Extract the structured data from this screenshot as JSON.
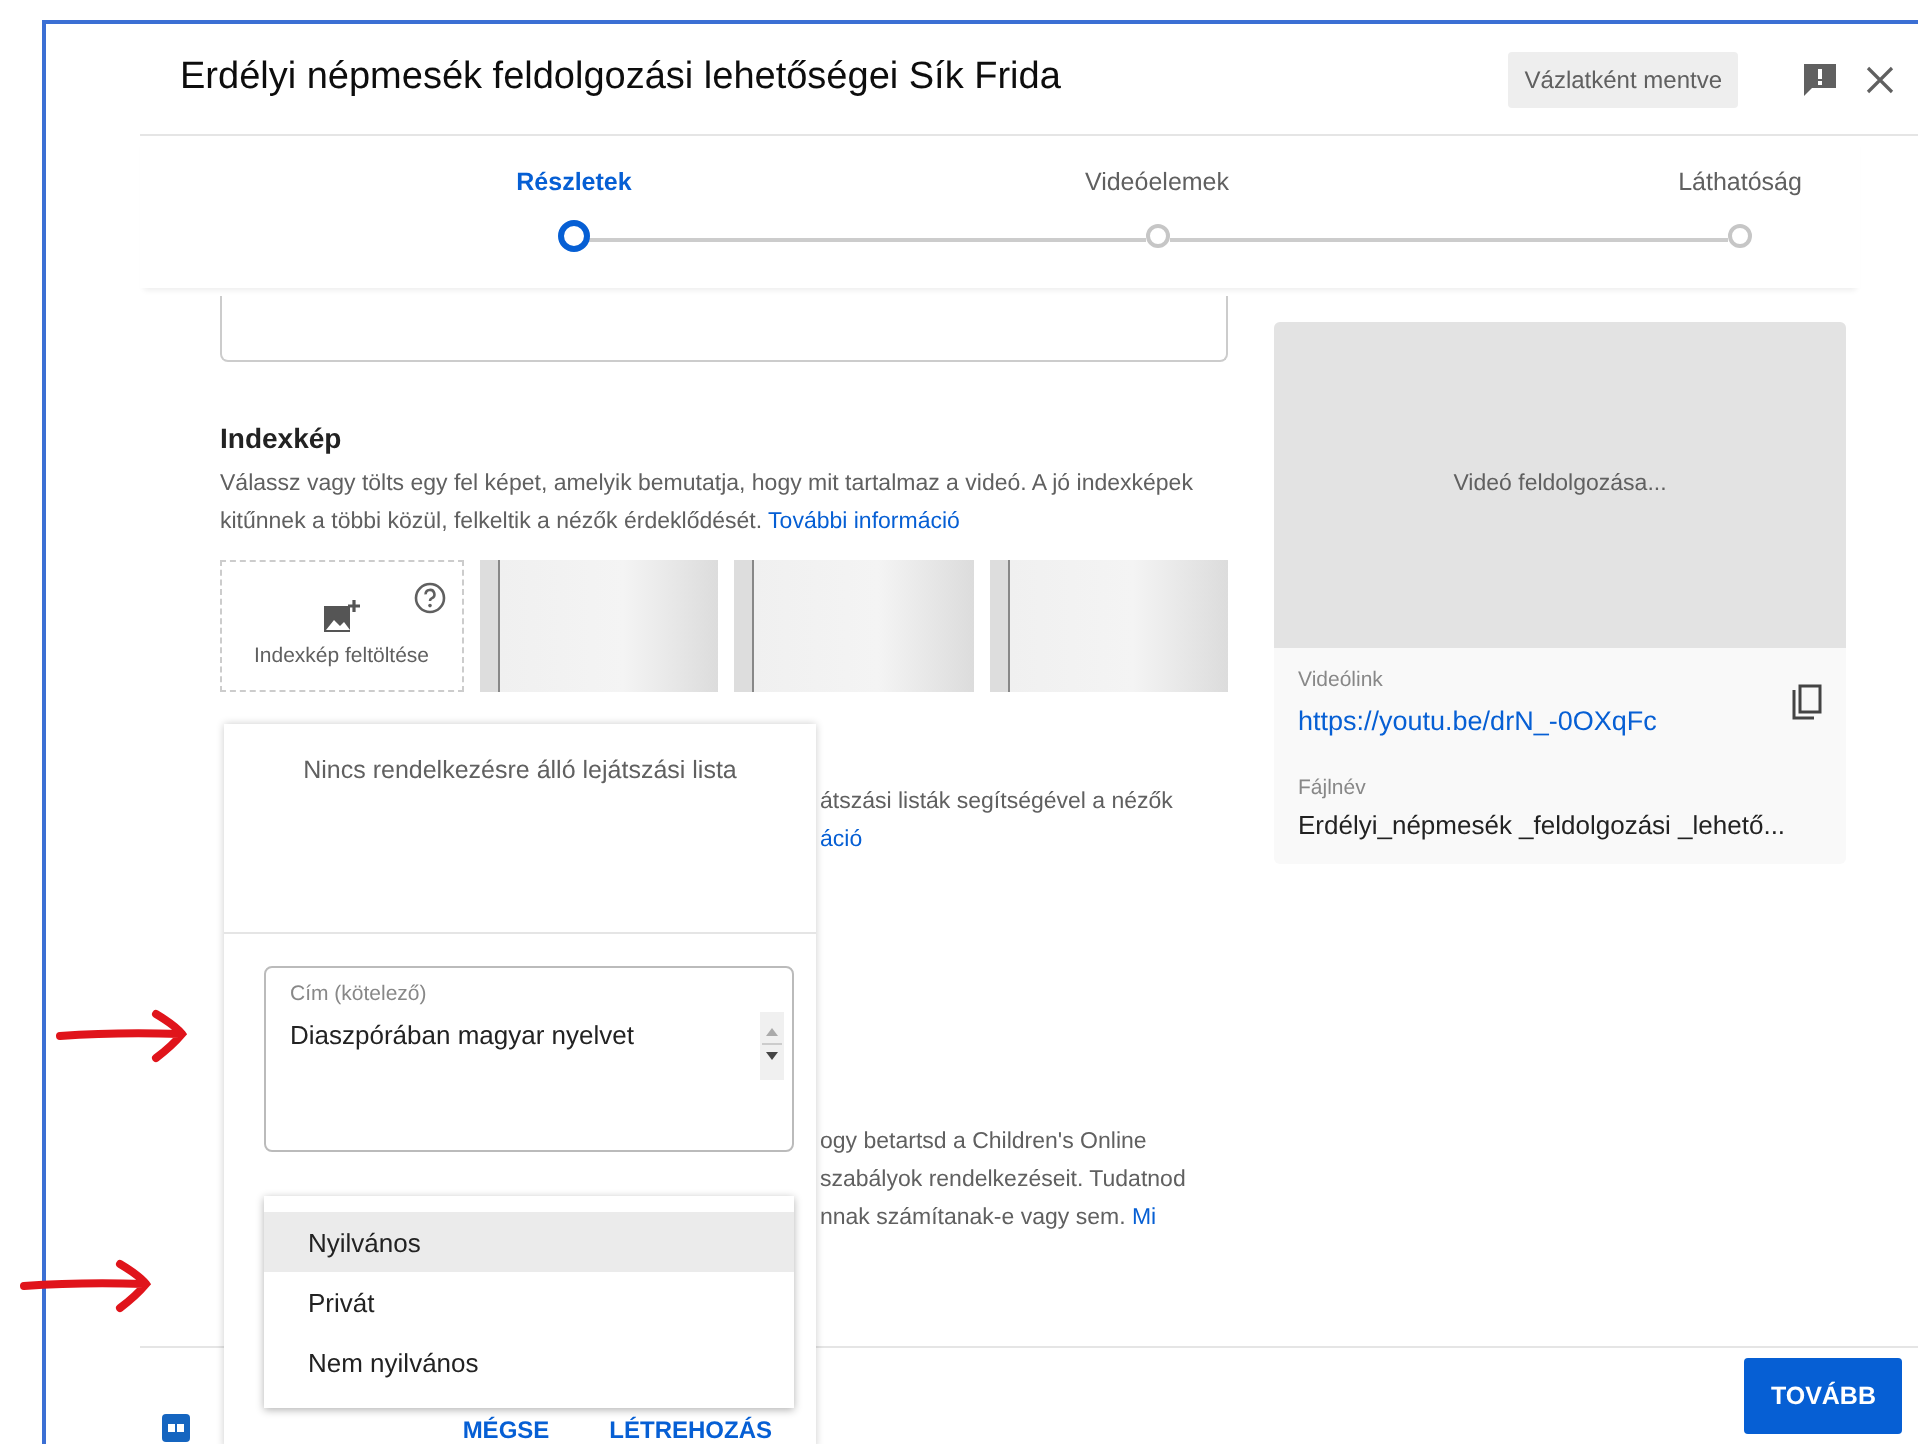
{
  "window": {
    "title": "Erdélyi népmesék feldolgozási lehetőségei Sík Frida",
    "status_badge": "Vázlatként mentve"
  },
  "steps": [
    {
      "label": "Részletek",
      "selected": true
    },
    {
      "label": "Videóelemek",
      "selected": false
    },
    {
      "label": "Láthatóság",
      "selected": false
    }
  ],
  "thumbnail": {
    "heading": "Indexkép",
    "description": "Válassz vagy tölts egy fel képet, amelyik bemutatja, hogy mit tartalmaz a videó. A jó indexképek kitűnnek a többi közül, felkeltik a nézők érdeklődését.",
    "link": "További információ",
    "upload_label": "Indexkép feltöltése",
    "slots": [
      {
        "kind": "placeholder"
      },
      {
        "kind": "placeholder"
      },
      {
        "kind": "placeholder"
      }
    ]
  },
  "playlist_section": {
    "text": "átszási listák segítségével a nézők",
    "link": "áció"
  },
  "audience_section": {
    "lines": [
      "ogy betartsd a Children's Online",
      "szabályok rendelkezéseit. Tudatnod",
      "nnak számítanak-e vagy sem."
    ],
    "link": "Mi"
  },
  "preview": {
    "status": "Videó feldolgozása...",
    "link_label": "Videólink",
    "link": "https://youtu.be/drN_-0OXqFc",
    "file_label": "Fájlnév",
    "file_name": "Erdélyi_népmesék _feldolgozási _lehető..."
  },
  "playlist_popup": {
    "empty_text": "Nincs rendelkezésre álló lejátszási lista",
    "title_field": {
      "label": "Cím (kötelező)",
      "value": "Diaszpórában magyar nyelvet"
    },
    "visibility_menu": [
      {
        "label": "Nyilvános",
        "selected": true
      },
      {
        "label": "Privát",
        "selected": false
      },
      {
        "label": "Nem nyilvános",
        "selected": false
      }
    ],
    "buttons": [
      "MÉGSE",
      "LÉTREHOZÁS"
    ]
  },
  "footer": {
    "next_button": "TOVÁBB"
  }
}
